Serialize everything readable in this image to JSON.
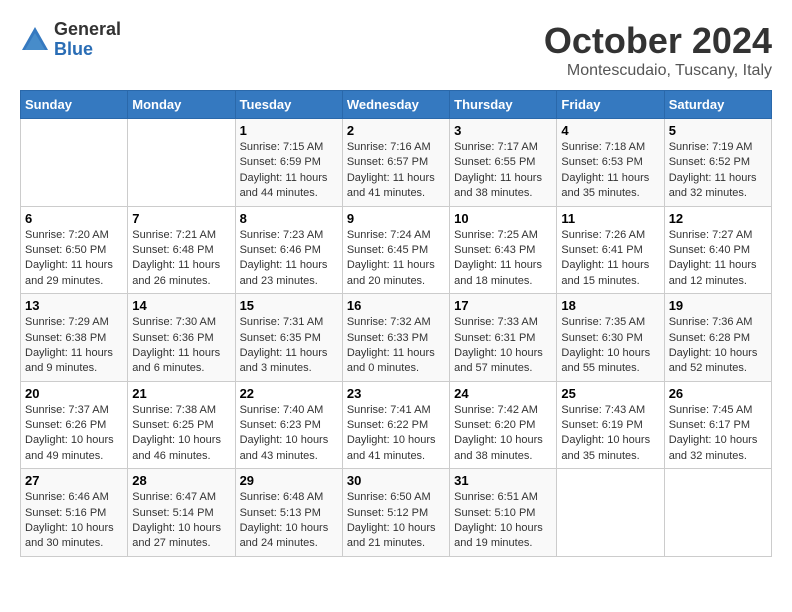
{
  "header": {
    "logo_general": "General",
    "logo_blue": "Blue",
    "month": "October 2024",
    "location": "Montescudaio, Tuscany, Italy"
  },
  "days_of_week": [
    "Sunday",
    "Monday",
    "Tuesday",
    "Wednesday",
    "Thursday",
    "Friday",
    "Saturday"
  ],
  "weeks": [
    [
      {
        "day": "",
        "info": ""
      },
      {
        "day": "",
        "info": ""
      },
      {
        "day": "1",
        "info": "Sunrise: 7:15 AM\nSunset: 6:59 PM\nDaylight: 11 hours and 44 minutes."
      },
      {
        "day": "2",
        "info": "Sunrise: 7:16 AM\nSunset: 6:57 PM\nDaylight: 11 hours and 41 minutes."
      },
      {
        "day": "3",
        "info": "Sunrise: 7:17 AM\nSunset: 6:55 PM\nDaylight: 11 hours and 38 minutes."
      },
      {
        "day": "4",
        "info": "Sunrise: 7:18 AM\nSunset: 6:53 PM\nDaylight: 11 hours and 35 minutes."
      },
      {
        "day": "5",
        "info": "Sunrise: 7:19 AM\nSunset: 6:52 PM\nDaylight: 11 hours and 32 minutes."
      }
    ],
    [
      {
        "day": "6",
        "info": "Sunrise: 7:20 AM\nSunset: 6:50 PM\nDaylight: 11 hours and 29 minutes."
      },
      {
        "day": "7",
        "info": "Sunrise: 7:21 AM\nSunset: 6:48 PM\nDaylight: 11 hours and 26 minutes."
      },
      {
        "day": "8",
        "info": "Sunrise: 7:23 AM\nSunset: 6:46 PM\nDaylight: 11 hours and 23 minutes."
      },
      {
        "day": "9",
        "info": "Sunrise: 7:24 AM\nSunset: 6:45 PM\nDaylight: 11 hours and 20 minutes."
      },
      {
        "day": "10",
        "info": "Sunrise: 7:25 AM\nSunset: 6:43 PM\nDaylight: 11 hours and 18 minutes."
      },
      {
        "day": "11",
        "info": "Sunrise: 7:26 AM\nSunset: 6:41 PM\nDaylight: 11 hours and 15 minutes."
      },
      {
        "day": "12",
        "info": "Sunrise: 7:27 AM\nSunset: 6:40 PM\nDaylight: 11 hours and 12 minutes."
      }
    ],
    [
      {
        "day": "13",
        "info": "Sunrise: 7:29 AM\nSunset: 6:38 PM\nDaylight: 11 hours and 9 minutes."
      },
      {
        "day": "14",
        "info": "Sunrise: 7:30 AM\nSunset: 6:36 PM\nDaylight: 11 hours and 6 minutes."
      },
      {
        "day": "15",
        "info": "Sunrise: 7:31 AM\nSunset: 6:35 PM\nDaylight: 11 hours and 3 minutes."
      },
      {
        "day": "16",
        "info": "Sunrise: 7:32 AM\nSunset: 6:33 PM\nDaylight: 11 hours and 0 minutes."
      },
      {
        "day": "17",
        "info": "Sunrise: 7:33 AM\nSunset: 6:31 PM\nDaylight: 10 hours and 57 minutes."
      },
      {
        "day": "18",
        "info": "Sunrise: 7:35 AM\nSunset: 6:30 PM\nDaylight: 10 hours and 55 minutes."
      },
      {
        "day": "19",
        "info": "Sunrise: 7:36 AM\nSunset: 6:28 PM\nDaylight: 10 hours and 52 minutes."
      }
    ],
    [
      {
        "day": "20",
        "info": "Sunrise: 7:37 AM\nSunset: 6:26 PM\nDaylight: 10 hours and 49 minutes."
      },
      {
        "day": "21",
        "info": "Sunrise: 7:38 AM\nSunset: 6:25 PM\nDaylight: 10 hours and 46 minutes."
      },
      {
        "day": "22",
        "info": "Sunrise: 7:40 AM\nSunset: 6:23 PM\nDaylight: 10 hours and 43 minutes."
      },
      {
        "day": "23",
        "info": "Sunrise: 7:41 AM\nSunset: 6:22 PM\nDaylight: 10 hours and 41 minutes."
      },
      {
        "day": "24",
        "info": "Sunrise: 7:42 AM\nSunset: 6:20 PM\nDaylight: 10 hours and 38 minutes."
      },
      {
        "day": "25",
        "info": "Sunrise: 7:43 AM\nSunset: 6:19 PM\nDaylight: 10 hours and 35 minutes."
      },
      {
        "day": "26",
        "info": "Sunrise: 7:45 AM\nSunset: 6:17 PM\nDaylight: 10 hours and 32 minutes."
      }
    ],
    [
      {
        "day": "27",
        "info": "Sunrise: 6:46 AM\nSunset: 5:16 PM\nDaylight: 10 hours and 30 minutes."
      },
      {
        "day": "28",
        "info": "Sunrise: 6:47 AM\nSunset: 5:14 PM\nDaylight: 10 hours and 27 minutes."
      },
      {
        "day": "29",
        "info": "Sunrise: 6:48 AM\nSunset: 5:13 PM\nDaylight: 10 hours and 24 minutes."
      },
      {
        "day": "30",
        "info": "Sunrise: 6:50 AM\nSunset: 5:12 PM\nDaylight: 10 hours and 21 minutes."
      },
      {
        "day": "31",
        "info": "Sunrise: 6:51 AM\nSunset: 5:10 PM\nDaylight: 10 hours and 19 minutes."
      },
      {
        "day": "",
        "info": ""
      },
      {
        "day": "",
        "info": ""
      }
    ]
  ]
}
